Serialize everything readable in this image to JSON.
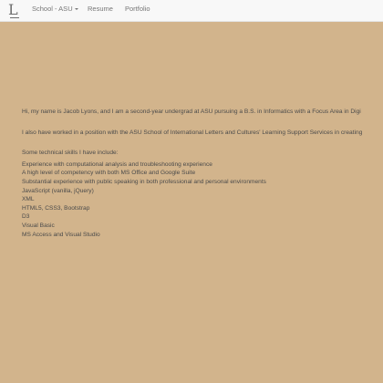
{
  "navbar": {
    "brand_label": "L",
    "items": [
      {
        "label": "School - ASU",
        "has_caret": true
      },
      {
        "label": "Resume"
      },
      {
        "label": "Portfolio"
      }
    ]
  },
  "main": {
    "intro": "Hi, my name is Jacob Lyons, and I am a second-year undergrad at ASU pursuing a B.S. in Informatics with a Focus Area in Digi",
    "work": "I also have worked in a position with the ASU School of International Letters and Cultures' Learning Support Services in creating",
    "skills_heading": "Some technical skills I have include:",
    "skills": [
      "Experience with computational analysis and troubleshooting experience",
      "A high level of competency with both MS Office and Google Suite",
      "Substantial experience with public speaking in both professional and personal environments",
      "JavaScript (vanilla, jQuery)",
      "XML",
      "HTML5, CSS3, Bootstrap",
      "D3",
      "Visual Basic",
      "MS Access and Visual Studio"
    ]
  },
  "colors": {
    "background": "#d2b48c",
    "navbar": "#f8f8f8",
    "text": "#4a4a4a"
  }
}
